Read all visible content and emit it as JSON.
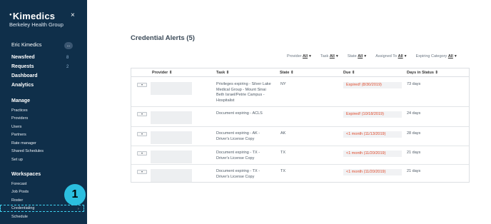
{
  "sidebar": {
    "brand": "Kimedics",
    "org": "Berkeley Health Group",
    "user": "Eric Kimedics",
    "more_icon": "...",
    "close_icon": "×",
    "main_nav": [
      {
        "label": "Newsfeed",
        "badge": "8"
      },
      {
        "label": "Requests",
        "badge": "2"
      },
      {
        "label": "Dashboard",
        "badge": ""
      },
      {
        "label": "Analytics",
        "badge": ""
      }
    ],
    "manage_heading": "Manage",
    "manage_items": [
      "Practices",
      "Providers",
      "Users",
      "Partners",
      "Rate manager",
      "Shared Schedules",
      "Set up"
    ],
    "workspaces_heading": "Workspaces",
    "workspace_items": [
      "Forecast",
      "Job Posts",
      "Roster",
      "Credentialing",
      "Schedule"
    ],
    "step_marker": "1"
  },
  "main": {
    "title": "Credential Alerts (5)",
    "filters": [
      {
        "label": "Provider",
        "value": "All"
      },
      {
        "label": "Task",
        "value": "All"
      },
      {
        "label": "State",
        "value": "All"
      },
      {
        "label": "Assigned To",
        "value": "All"
      },
      {
        "label": "Expiring Category",
        "value": "All"
      }
    ],
    "columns": [
      "Provider ⇕",
      "Task ⇕",
      "State ⇕",
      "Due ⇕",
      "Days in Status ⇕"
    ],
    "rows": [
      {
        "task": "Privileges expiring - Silver Lake Medical Group - Mount Sinai Beth Israel/Petrie Campus - Hospitalist",
        "state": "NY",
        "due": "Expired! (8/30/2019)",
        "days": "73 days"
      },
      {
        "task": "Document expiring - ACLS",
        "state": "",
        "due": "Expired! (10/18/2019)",
        "days": "24 days"
      },
      {
        "task": "Document expiring - AK - Driver's License Copy",
        "state": "AK",
        "due": "<1 month (11/13/2019)",
        "days": "28 days"
      },
      {
        "task": "Document expiring - TX - Driver's License Copy",
        "state": "TX",
        "due": "<1 month (11/20/2019)",
        "days": "21 days"
      },
      {
        "task": "Document expiring - TX - Driver's License Copy",
        "state": "TX",
        "due": "<1 month (11/20/2019)",
        "days": "21 days"
      }
    ],
    "colors": {
      "sidebar": "#0f2f4a",
      "expired": "#e04a2a",
      "highlight": "#2bbfe0"
    }
  }
}
